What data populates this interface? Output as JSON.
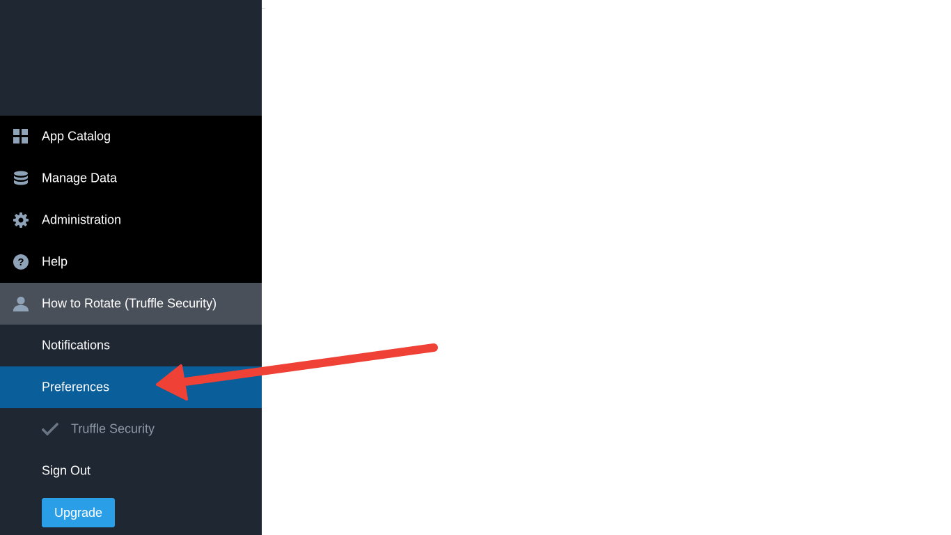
{
  "sidebar": {
    "main_items": [
      {
        "label": "App Catalog",
        "icon": "grid-icon"
      },
      {
        "label": "Manage Data",
        "icon": "database-icon"
      },
      {
        "label": "Administration",
        "icon": "gear-icon"
      },
      {
        "label": "Help",
        "icon": "help-circle-icon"
      }
    ],
    "user": {
      "label": "How to Rotate (Truffle Security)",
      "icon": "user-icon"
    },
    "user_menu": {
      "notifications": "Notifications",
      "preferences": "Preferences",
      "organization": "Truffle Security",
      "sign_out": "Sign Out",
      "upgrade": "Upgrade"
    }
  },
  "annotation": {
    "type": "arrow",
    "target": "Preferences",
    "color": "#ef4136"
  },
  "colors": {
    "sidebar_bg": "#1f2733",
    "main_nav_bg": "#000000",
    "user_bg": "#4a505a",
    "active_bg": "#0a5e99",
    "upgrade_bg": "#2b9ee8",
    "icon_color": "#8fa3b8"
  }
}
